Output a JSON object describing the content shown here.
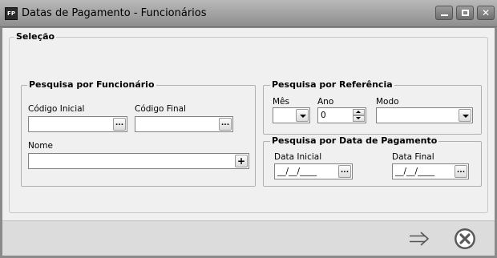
{
  "window": {
    "icon_text": "FP",
    "title": "Datas de Pagamento - Funcionários",
    "minimize": "minimize-icon",
    "maximize": "maximize-icon",
    "close_glyph": "✕"
  },
  "selecao": {
    "label": "Seleção",
    "funcionario": {
      "label": "Pesquisa por Funcionário",
      "codigo_inicial": {
        "label": "Código Inicial",
        "value": "",
        "button": "..."
      },
      "codigo_final": {
        "label": "Código Final",
        "value": "",
        "button": "..."
      },
      "nome": {
        "label": "Nome",
        "value": "",
        "button": "+"
      }
    },
    "referencia": {
      "label": "Pesquisa por Referência",
      "mes": {
        "label": "Mês",
        "value": ""
      },
      "ano": {
        "label": "Ano",
        "value": "0"
      },
      "modo": {
        "label": "Modo",
        "value": ""
      }
    },
    "data_pagamento": {
      "label": "Pesquisa por Data de Pagamento",
      "data_inicial": {
        "label": "Data Inicial",
        "value": "__/__/____",
        "button": "..."
      },
      "data_final": {
        "label": "Data Final",
        "value": "__/__/____",
        "button": "..."
      }
    }
  },
  "footer": {
    "next_icon": "arrow-right-icon",
    "cancel_icon": "cancel-circle-icon"
  }
}
